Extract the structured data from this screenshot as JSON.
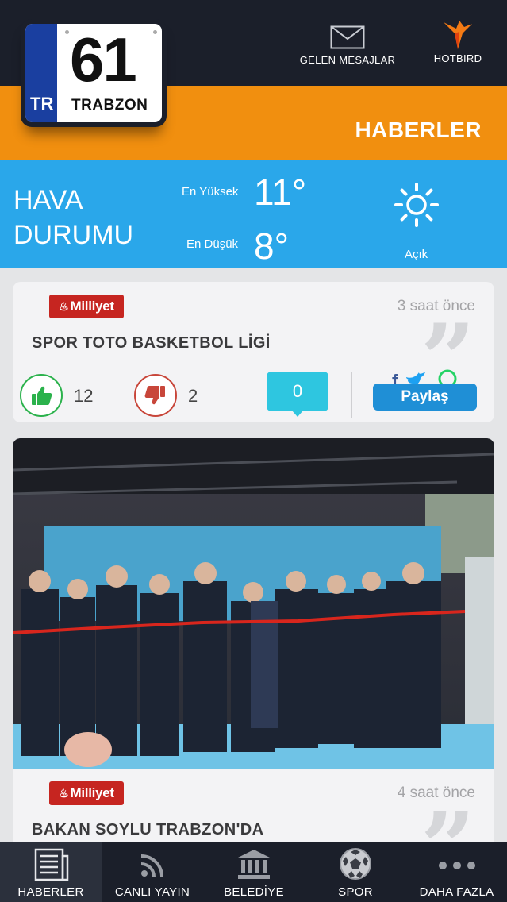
{
  "header": {
    "plate": {
      "country": "TR",
      "number": "61",
      "city": "TRABZON"
    },
    "messages_label": "GELEN MESAJLAR",
    "hotbird_label": "HOTBIRD",
    "section_title": "HABERLER"
  },
  "weather": {
    "title_line1": "HAVA",
    "title_line2": "DURUMU",
    "high_label": "En Yüksek",
    "high_value": "11°",
    "low_label": "En Düşük",
    "low_value": "8°",
    "condition": "Açık",
    "icon": "sun-icon"
  },
  "news": [
    {
      "source": "Milliyet",
      "time": "3 saat önce",
      "headline": "SPOR TOTO BASKETBOL LİGİ",
      "likes": "12",
      "dislikes": "2",
      "comments": "0",
      "share_label": "Paylaş"
    },
    {
      "source": "Milliyet",
      "time": "4 saat önce",
      "headline": "BAKAN SOYLU TRABZON'DA"
    }
  ],
  "tabs": [
    {
      "label": "HABERLER",
      "icon": "newspaper-icon",
      "active": true
    },
    {
      "label": "CANLI YAYIN",
      "icon": "broadcast-icon"
    },
    {
      "label": "BELEDİYE",
      "icon": "municipality-icon"
    },
    {
      "label": "SPOR",
      "icon": "soccer-ball-icon"
    },
    {
      "label": "DAHA FAZLA",
      "icon": "more-icon"
    }
  ],
  "colors": {
    "dark": "#1b1f2a",
    "orange": "#f18f0f",
    "sky": "#2aa7ea",
    "like": "#2bb24c",
    "dislike": "#c8463a",
    "comment": "#2ec6e0",
    "share": "#1f8fd6",
    "milliyet": "#c62520"
  }
}
